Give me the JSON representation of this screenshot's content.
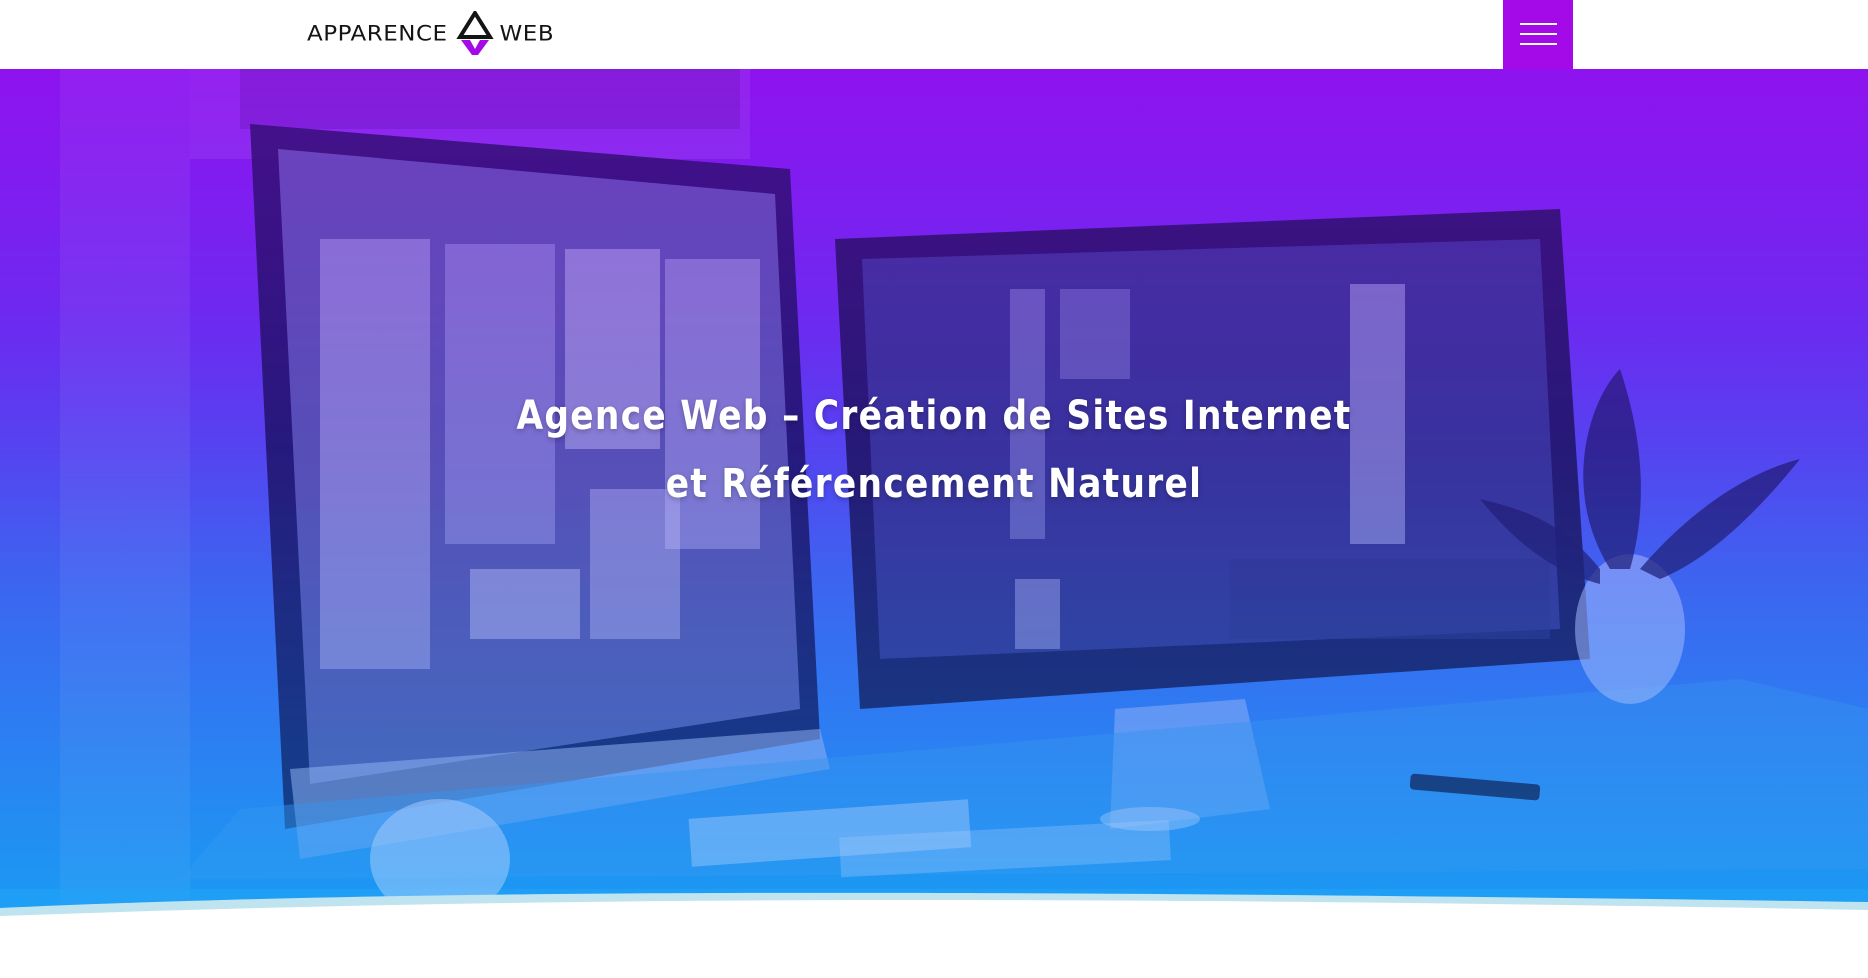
{
  "header": {
    "logo_left": "APPARENCE",
    "logo_right": "WEB",
    "menu_icon": "hamburger-menu-icon"
  },
  "hero": {
    "title": "Agence Web – Création de Sites Internet et Référencement Naturel",
    "background_image": "desk-with-two-monitors-photo"
  },
  "colors": {
    "accent": "#a40ae8",
    "gradient_top": "#8a12ef",
    "gradient_bottom": "#1e9cf2",
    "header_bg": "#ffffff"
  }
}
